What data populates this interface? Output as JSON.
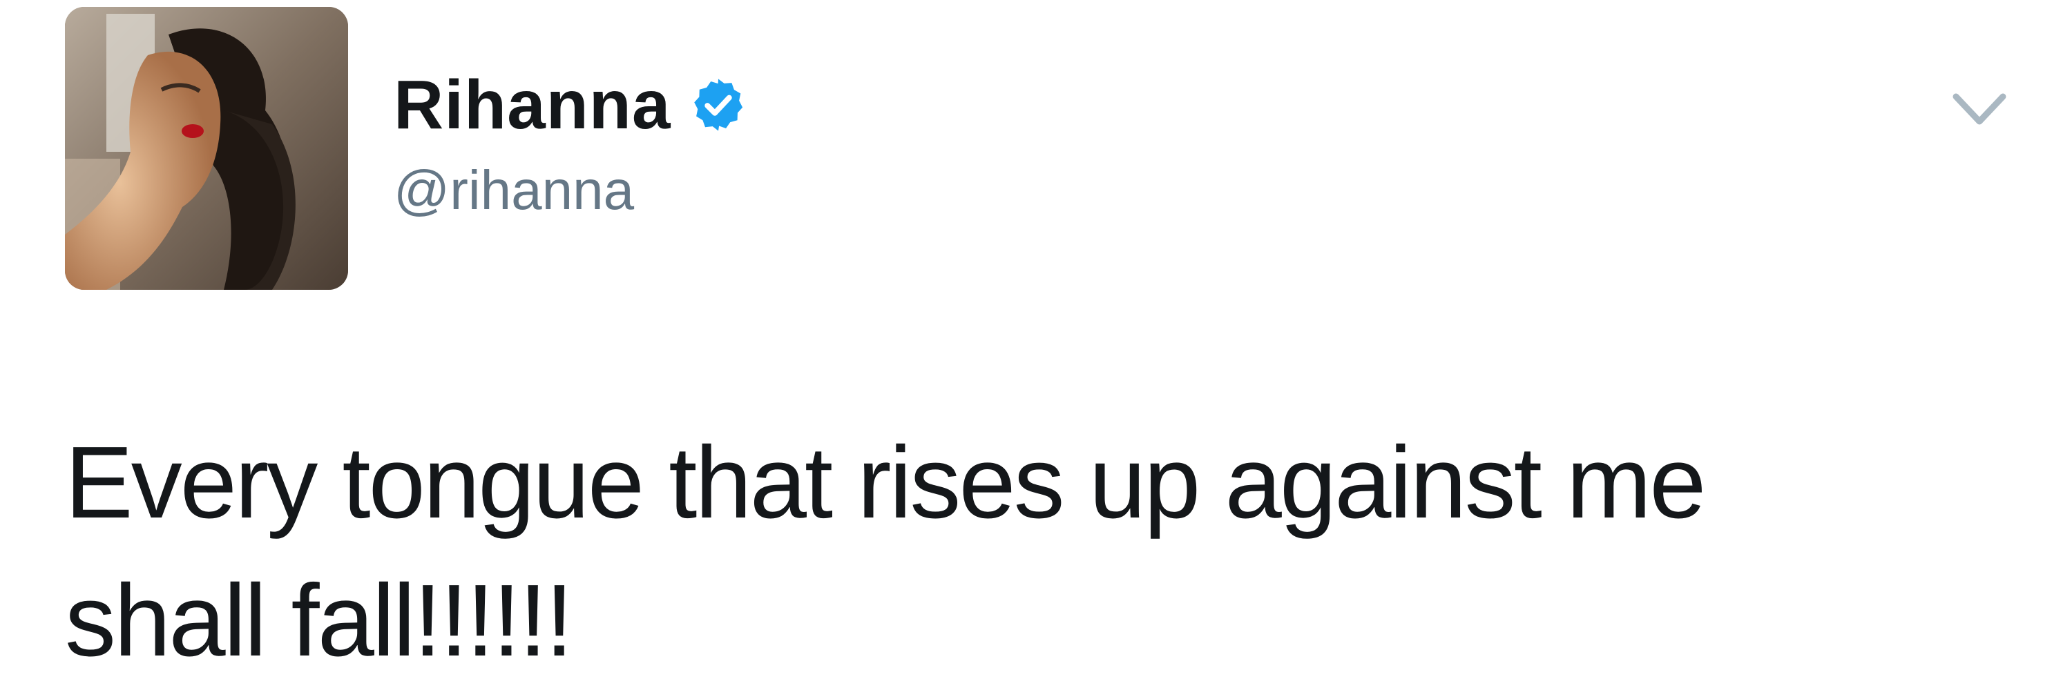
{
  "tweet": {
    "author": {
      "display_name": "Rihanna",
      "handle": "@rihanna",
      "verified": true,
      "avatar_icon": "profile-photo",
      "verified_icon": "verified-badge-icon",
      "verified_color": "#1da1f2"
    },
    "menu_icon": "chevron-down-icon",
    "text_lines": [
      "Every tongue that rises up against me",
      "shall fall!!!!!!"
    ]
  },
  "colors": {
    "background": "#ffffff",
    "primary_text": "#14171a",
    "secondary_text": "#657786",
    "caret": "#aab8c2"
  }
}
